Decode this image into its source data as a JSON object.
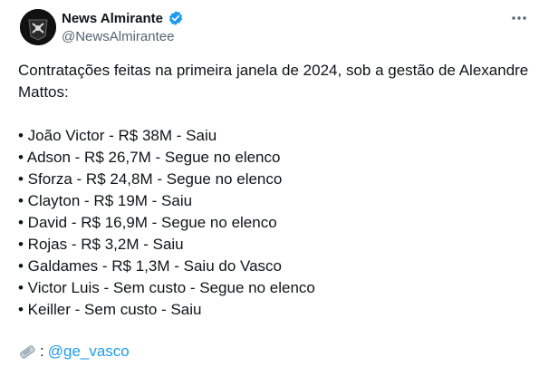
{
  "author": {
    "name": "News Almirante",
    "handle": "@NewsAlmirantee",
    "avatar_icon": "club-logo-avatar",
    "verified_icon": "verified-badge-icon",
    "verified_color": "#1d9bf0"
  },
  "more_icon": "more-options-icon",
  "tweet": {
    "intro": "Contratações feitas na primeira janela de 2024, sob a gestão de Alexandre Mattos:",
    "items": [
      "• João Victor - R$ 38M - Saiu",
      "• Adson - R$ 26,7M - Segue no elenco",
      "• Sforza - R$ 24,8M - Segue no elenco",
      "• Clayton - R$ 19M - Saiu",
      "• David - R$ 16,9M - Segue no elenco",
      "• Rojas - R$ 3,2M - Saiu",
      "• Galdames - R$ 1,3M - Saiu do Vasco",
      "• Victor Luis - Sem custo - Segue no elenco",
      "• Keiller - Sem custo - Saiu"
    ],
    "source_prefix": ":",
    "source_mention": "@ge_vasco",
    "source_icon": "newspaper-icon"
  },
  "colors": {
    "text": "#0f1419",
    "secondary": "#536471",
    "link": "#1d9bf0"
  }
}
